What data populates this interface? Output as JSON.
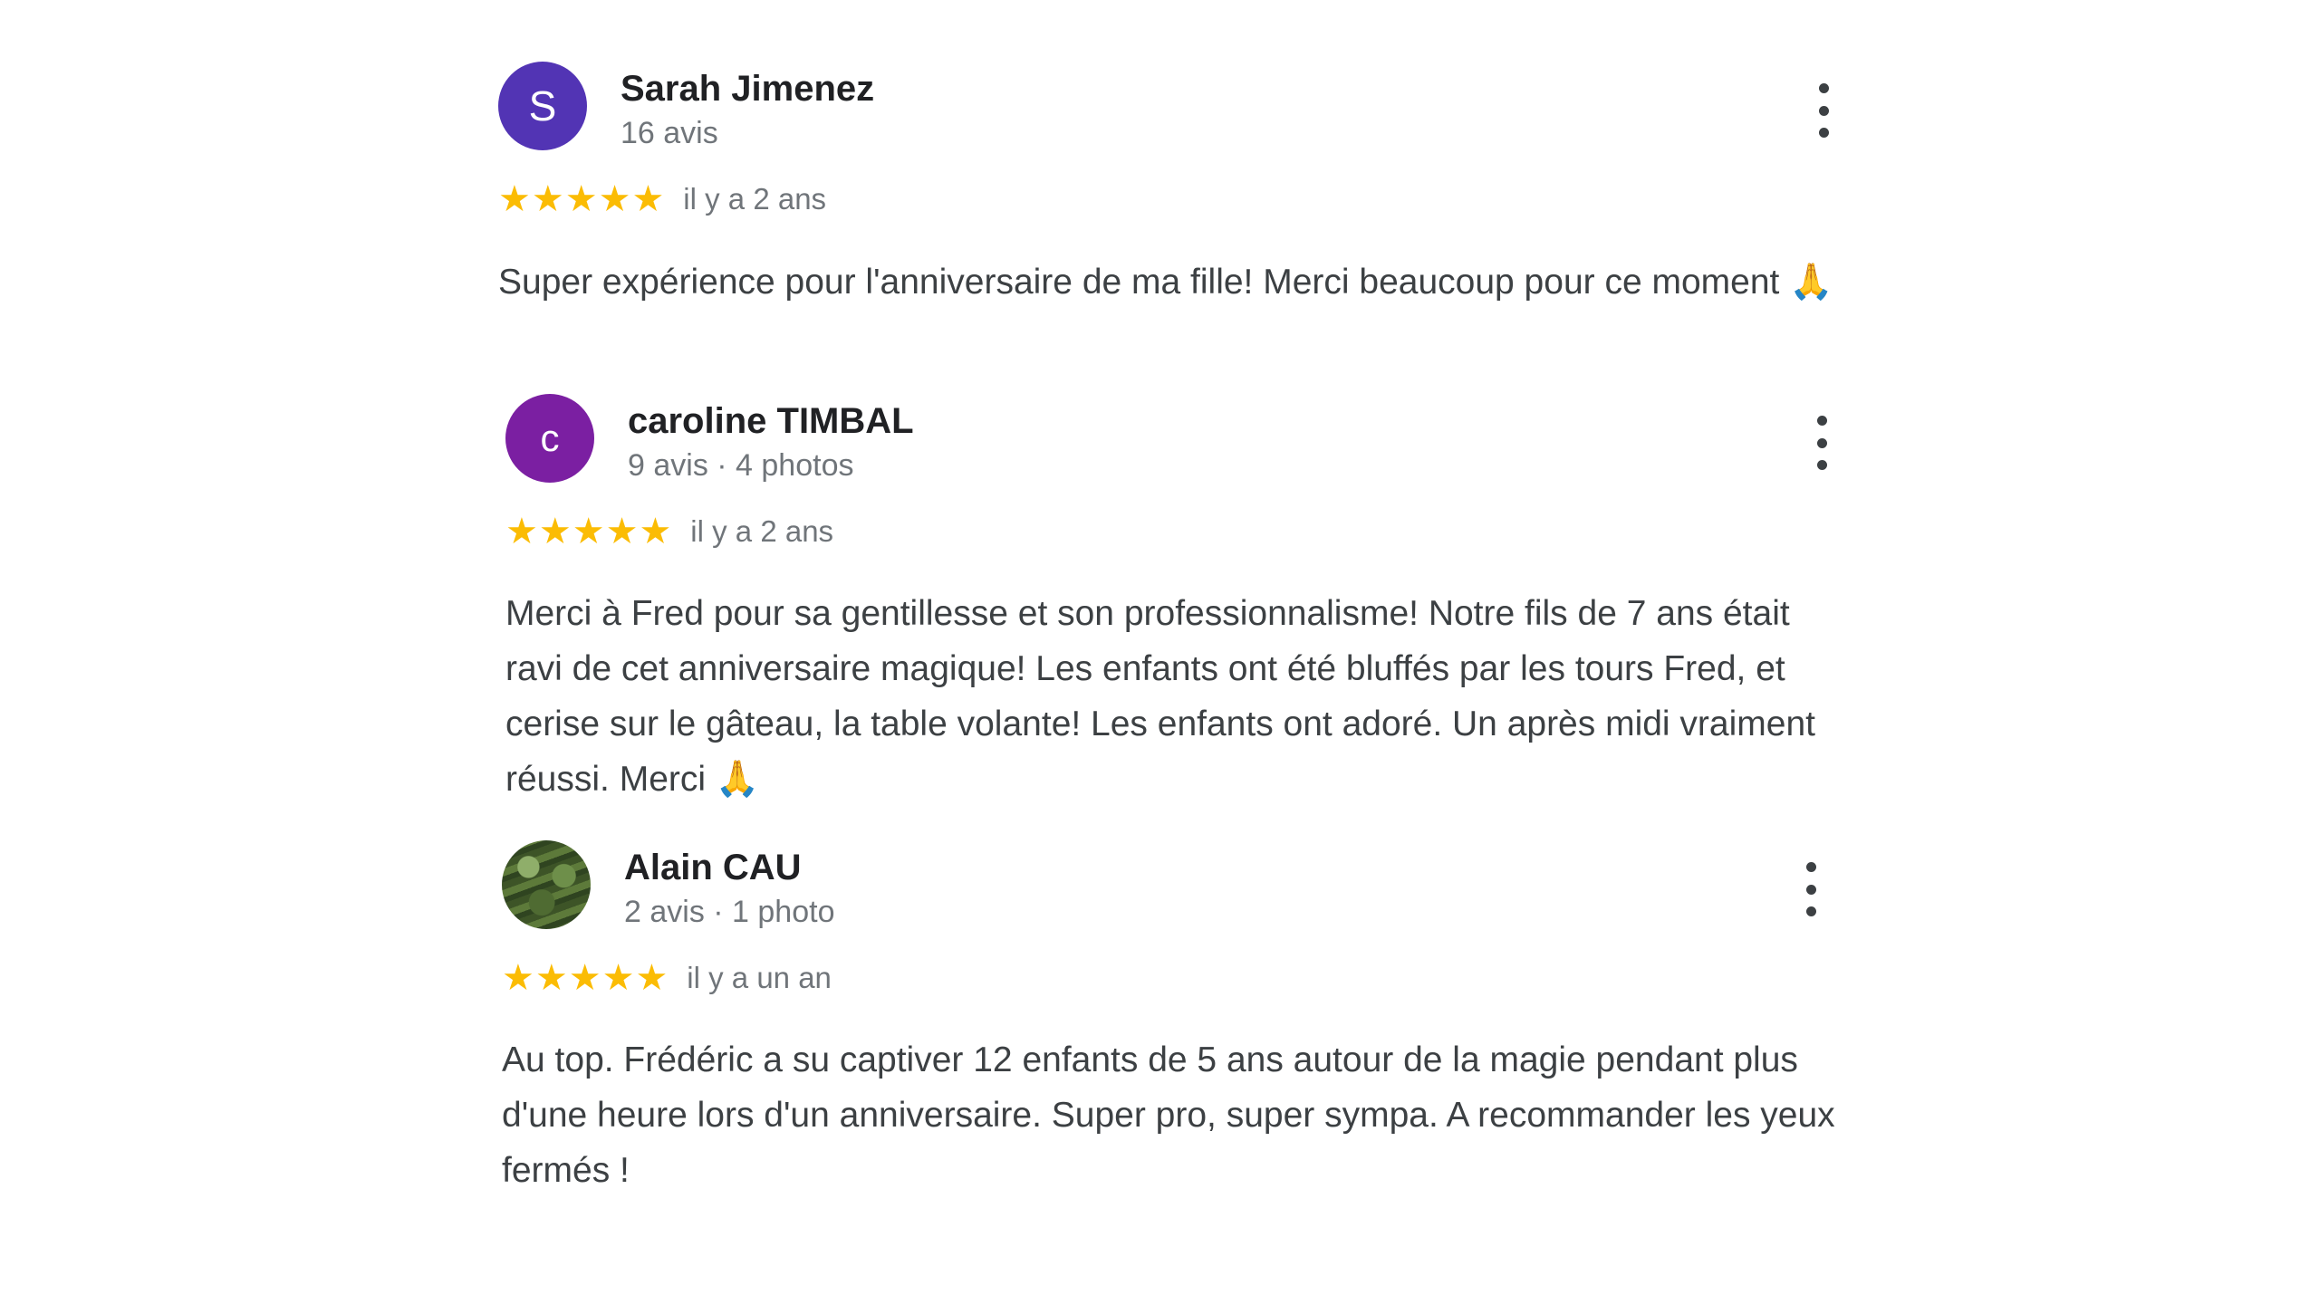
{
  "reviews": [
    {
      "avatar_letter": "S",
      "avatar_color": "#5234b4",
      "name": "Sarah Jimenez",
      "meta": "16 avis",
      "stars": "★★★★★",
      "rating": 5,
      "date": "il y a 2 ans",
      "text": "Super expérience pour l'anniversaire de ma fille! Merci beaucoup pour ce moment",
      "emoji": "🙏"
    },
    {
      "avatar_letter": "c",
      "avatar_color": "#7b1fa2",
      "name": "caroline TIMBAL",
      "meta": "9 avis · 4 photos",
      "stars": "★★★★★",
      "rating": 5,
      "date": "il y a 2 ans",
      "text": "Merci à Fred pour sa gentillesse et son professionnalisme! Notre fils de 7 ans était ravi de cet anniversaire magique! Les enfants ont été bluffés par les tours Fred, et cerise sur le gâteau, la table volante! Les enfants ont adoré. Un après midi vraiment réussi. Merci",
      "emoji": "🙏"
    },
    {
      "avatar_letter": "",
      "avatar_color": "#4f6b32",
      "name": "Alain CAU",
      "meta": "2 avis · 1 photo",
      "stars": "★★★★★",
      "rating": 5,
      "date": "il y a un an",
      "text": "Au top. Frédéric a su captiver 12 enfants de 5 ans autour de la magie pendant plus d'une heure lors d'un anniversaire. Super pro, super sympa. A recommander les yeux fermés !"
    }
  ],
  "colors": {
    "star": "#fbbc04",
    "name": "#202124",
    "meta": "#70757a",
    "body_text": "#3c4043"
  }
}
